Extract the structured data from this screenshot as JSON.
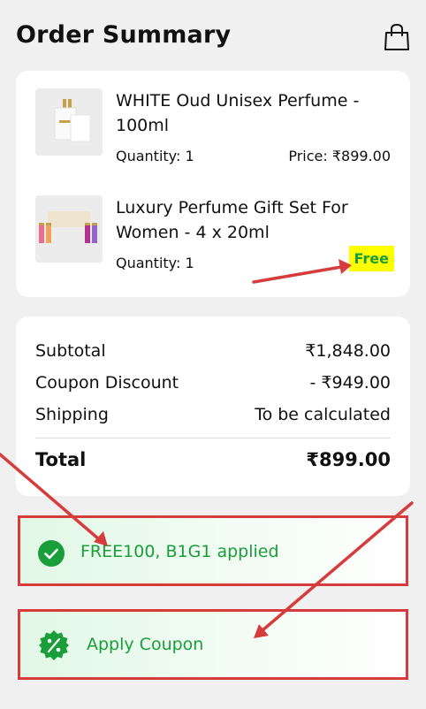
{
  "header": {
    "title": "Order Summary",
    "cart_icon": "shopping-bag-icon"
  },
  "items": [
    {
      "name": "WHITE Oud Unisex Perfume - 100ml",
      "quantity": "Quantity: 1",
      "price": "Price: ₹899.00"
    },
    {
      "name": "Luxury Perfume Gift Set For Women - 4 x 20ml",
      "quantity": "Quantity: 1",
      "price": "Free"
    }
  ],
  "totals": {
    "subtotal_label": "Subtotal",
    "subtotal_value": "₹1,848.00",
    "discount_label": "Coupon Discount",
    "discount_value": "- ₹949.00",
    "shipping_label": "Shipping",
    "shipping_value": "To be calculated",
    "total_label": "Total",
    "total_value": "₹899.00"
  },
  "coupon": {
    "applied_text": "FREE100, B1G1 applied",
    "apply_label": "Apply Coupon"
  },
  "colors": {
    "accent_green": "#1a9e3a",
    "highlight_yellow": "#ffff00",
    "annotation_red": "#d73c3c"
  }
}
